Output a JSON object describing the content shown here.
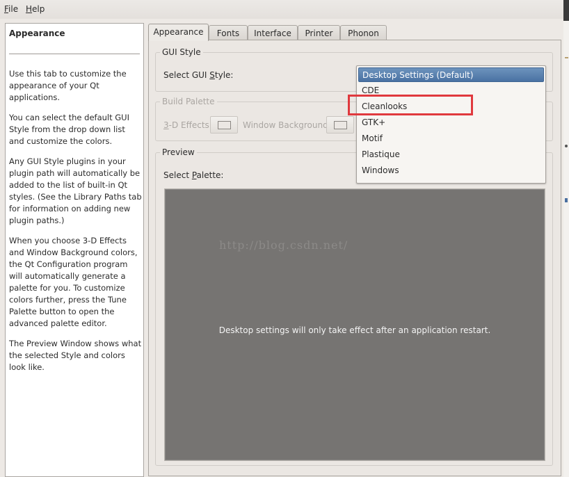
{
  "menubar": {
    "items": [
      {
        "label": "File",
        "mnemonic": "F",
        "rest": "ile"
      },
      {
        "label": "Help",
        "mnemonic": "H",
        "rest": "elp"
      }
    ]
  },
  "help": {
    "title": "Appearance",
    "paragraphs": [
      "Use this tab to customize the appearance of your Qt applications.",
      "You can select the default GUI Style from the drop down list and customize the colors.",
      "Any GUI Style plugins in your plugin path will automatically be added to the list of built-in Qt styles. (See the Library Paths tab for information on adding new plugin paths.)",
      "When you choose 3-D Effects and Window Background colors, the Qt Configuration program will automatically generate a palette for you. To customize colors further, press the Tune Palette button to open the advanced palette editor.",
      "The Preview Window shows what the selected Style and colors look like."
    ]
  },
  "tabs": [
    {
      "label": "Appearance",
      "active": true
    },
    {
      "label": "Fonts",
      "active": false
    },
    {
      "label": "Interface",
      "active": false
    },
    {
      "label": "Printer",
      "active": false
    },
    {
      "label": "Phonon",
      "active": false
    }
  ],
  "gui_style": {
    "group_title": "GUI Style",
    "label_pre": "Select GUI ",
    "label_mnemonic": "S",
    "label_post": "tyle:",
    "selected": "Desktop Settings (Default)",
    "options": [
      "Desktop Settings (Default)",
      "CDE",
      "Cleanlooks",
      "GTK+",
      "Motif",
      "Plastique",
      "Windows"
    ],
    "highlighted_option": "Cleanlooks"
  },
  "build_palette": {
    "group_title": "Build Palette",
    "effects_mnemonic": "3",
    "effects_rest": "-D Effects:",
    "window_bg_pre": "Window Back",
    "window_bg_mnemonic": "g",
    "window_bg_post": "round:",
    "enabled": false
  },
  "preview": {
    "group_title": "Preview",
    "palette_label_pre": "Select ",
    "palette_label_mnemonic": "P",
    "palette_label_post": "alette:",
    "message": "Desktop settings will only take effect after an application restart.",
    "watermark": "http://blog.csdn.net/"
  },
  "colors": {
    "accent": "#4a72a3",
    "highlight_box": "#e0393e",
    "preview_bg": "#767472"
  }
}
